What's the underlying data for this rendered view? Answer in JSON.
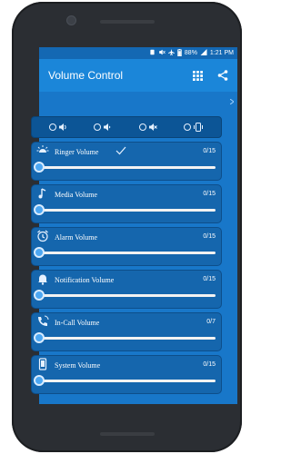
{
  "statusbar": {
    "battery": "88%",
    "time": "1:21 PM"
  },
  "appbar": {
    "title": "Volume Control"
  },
  "mode_icons": [
    "ring-mode-icon",
    "vibrate-off-mode-icon",
    "silent-mode-icon",
    "vibrate-mode-icon"
  ],
  "volumes": [
    {
      "label": "Ringer Volume",
      "value": "0/15",
      "icon": "ringer-icon",
      "level": 0
    },
    {
      "label": "Media Volume",
      "value": "0/15",
      "icon": "music-note-icon",
      "level": 0
    },
    {
      "label": "Alarm Volume",
      "value": "0/15",
      "icon": "alarm-clock-icon",
      "level": 0
    },
    {
      "label": "Notification Volume",
      "value": "0/15",
      "icon": "bell-icon",
      "level": 0
    },
    {
      "label": "In-Call Volume",
      "value": "0/7",
      "icon": "phone-call-icon",
      "level": 0
    },
    {
      "label": "System Volume",
      "value": "0/15",
      "icon": "phone-system-icon",
      "level": 0
    }
  ],
  "colors": {
    "accent": "#1b86d9",
    "card": "#1566ad",
    "screen": "#1877c9"
  }
}
